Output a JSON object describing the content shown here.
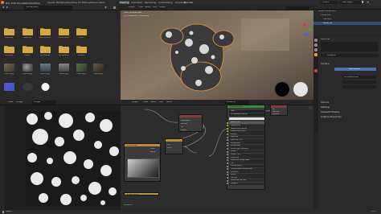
{
  "window": {
    "title": "Blender"
  },
  "menubar": {
    "menus": [
      "File",
      "Edit",
      "Render",
      "Window",
      "Help"
    ],
    "tabs": [
      "Layout",
      "Modeling",
      "Sculpting",
      "UV Editing",
      "Texture Paint",
      "Shading",
      "Animation",
      "Rendering",
      "Compositing",
      "Scripting"
    ],
    "active_tab": "Shading",
    "scene_label": "Scene",
    "view_layer_label": "View Layer"
  },
  "filebrowser": {
    "path": "/home/user/",
    "folders": [
      "Desktop",
      "Desktop",
      "Documents",
      "Downloads",
      "Music",
      "Pictures",
      "Public",
      "Templates",
      "Templates",
      "Videos"
    ],
    "files": [
      "file01.jpg",
      "file02.jpg",
      "file03.jpg",
      "file04.jpg",
      "file05.jpg",
      "file06.jpg"
    ]
  },
  "viewport": {
    "view_name": "User Perspective",
    "collection": "(1) Collection | Suzanne",
    "menus": [
      "Object",
      "View",
      "Select",
      "Add",
      "Object"
    ]
  },
  "outliner": {
    "title": "Scene Collection",
    "items": [
      "Collection",
      "Camera",
      "Suzanne"
    ]
  },
  "properties": {
    "object_name": "Suzanne",
    "material_name": "Material",
    "surface_label": "Surface",
    "use_nodes_label": "Use Nodes",
    "surface_value": "Principled BSDF",
    "volume_label": "Volume",
    "settings_label": "Settings",
    "viewport_display_label": "Viewport Display",
    "custom_props_label": "Custom Properties"
  },
  "imageeditor": {
    "image_name": "Image",
    "menus": [
      "View",
      "Image"
    ]
  },
  "nodeeditor": {
    "menus": [
      "Object",
      "View",
      "Select",
      "Add",
      "Node"
    ],
    "material": "Material",
    "nodes": {
      "texcoord": {
        "title": "Texture Coordinate",
        "outputs": [
          "Generated",
          "Normal",
          "UV",
          "Object"
        ]
      },
      "noise": {
        "title": "Noise Texture",
        "outputs": [
          "Fac",
          "Color"
        ]
      },
      "colorramp": {
        "title": "ColorRamp",
        "outputs": [
          "Color",
          "Alpha"
        ]
      },
      "bsdf": {
        "title": "Principled BSDF",
        "rows": [
          "GGX",
          "Christensen-Burley",
          "Base Color",
          "Subsurface",
          "Subsurface Radius",
          "Subsurface Color",
          "Metallic",
          "Specular",
          "Specular Tint",
          "Roughness",
          "Anisotropic",
          "Anisotropic Rotation",
          "Sheen",
          "Sheen Tint",
          "Clearcoat",
          "Clearcoat Roughness",
          "IOR",
          "Transmission",
          "Transmission Roughness",
          "Emission",
          "Alpha",
          "Normal",
          "Clearcoat Normal",
          "Tangent"
        ]
      },
      "output": {
        "title": "Material Output",
        "rows": [
          "All",
          "Surface",
          "Volume",
          "Displacement"
        ]
      },
      "image": {
        "title": "Image Texture"
      }
    }
  },
  "statusbar": {
    "label": "Select",
    "version": "2.83"
  }
}
